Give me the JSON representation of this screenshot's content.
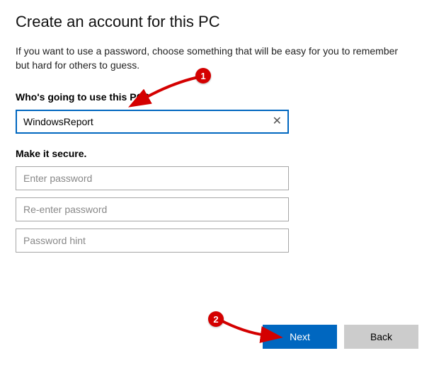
{
  "title": "Create an account for this PC",
  "description": "If you want to use a password, choose something that will be easy for you to remember but hard for others to guess.",
  "section_user": {
    "label": "Who's going to use this PC?",
    "username_value": "WindowsReport"
  },
  "section_secure": {
    "label": "Make it secure.",
    "password_placeholder": "Enter password",
    "confirm_placeholder": "Re-enter password",
    "hint_placeholder": "Password hint"
  },
  "buttons": {
    "next": "Next",
    "back": "Back"
  },
  "annotations": {
    "badge1": "1",
    "badge2": "2"
  }
}
